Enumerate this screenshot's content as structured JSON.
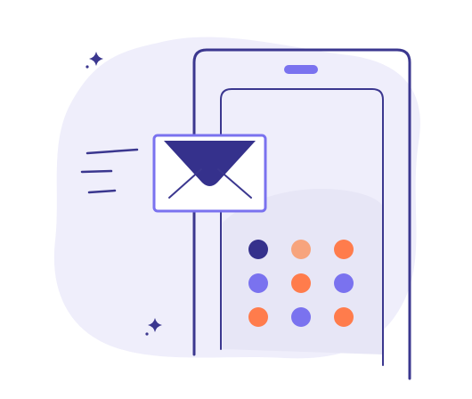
{
  "illustration": {
    "subject": "new-message-notification",
    "icons": [
      "phone-icon",
      "envelope-icon",
      "sparkle-icon",
      "speed-lines-icon",
      "app-grid-icon"
    ]
  },
  "colors": {
    "background": "#ffffff",
    "blob": "#efeefb",
    "outline": "#3b378f",
    "envelope_flap": "#35318c",
    "envelope_border": "#7a72ef",
    "screen_panel": "#e7e6f6",
    "speaker": "#7a72ef",
    "dot_navy": "#35318c",
    "dot_peach": "#f7a47d",
    "dot_orange": "#ff7c4c",
    "dot_purple": "#7a72ef"
  },
  "app_grid": {
    "rows": 3,
    "columns": 3,
    "dot_colors": [
      [
        "dot_navy",
        "dot_peach",
        "dot_orange"
      ],
      [
        "dot_purple",
        "dot_orange",
        "dot_purple"
      ],
      [
        "dot_orange",
        "dot_purple",
        "dot_orange"
      ]
    ]
  }
}
